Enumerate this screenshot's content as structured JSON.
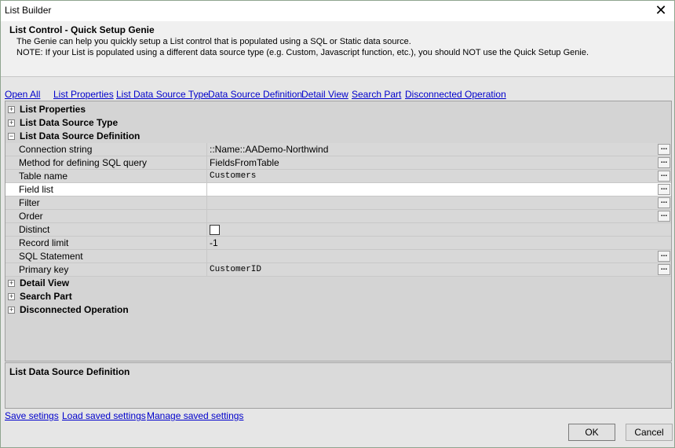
{
  "window": {
    "title": "List Builder",
    "close_glyph": "✕"
  },
  "header": {
    "title": "List Control - Quick Setup Genie",
    "line1": "The Genie can help you quickly setup a List control that is populated using a SQL or Static data source.",
    "line2": "NOTE: If your List is populated using a different data source type (e.g. Custom, Javascript function, etc.), you should NOT use the Quick Setup Genie."
  },
  "nav": {
    "open_all": "Open All",
    "list_properties": "List Properties",
    "list_data_source_type": "List Data Source Type",
    "data_source_definition": "Data Source Definition",
    "detail_view": "Detail View",
    "search_part": "Search Part",
    "disconnected_operation": "Disconnected Operation"
  },
  "grid": {
    "categories": {
      "list_properties": {
        "label": "List Properties",
        "toggle": "+"
      },
      "list_data_source_type": {
        "label": "List Data Source Type",
        "toggle": "+"
      },
      "list_data_source_definition": {
        "label": "List Data Source Definition",
        "toggle": "−"
      },
      "detail_view": {
        "label": "Detail View",
        "toggle": "+"
      },
      "search_part": {
        "label": "Search Part",
        "toggle": "+"
      },
      "disconnected_operation": {
        "label": "Disconnected Operation",
        "toggle": "+"
      }
    },
    "props": {
      "connection_string": {
        "label": "Connection string",
        "value": "::Name::AADemo-Northwind"
      },
      "method": {
        "label": "Method for defining SQL query",
        "value": "FieldsFromTable"
      },
      "table_name": {
        "label": "Table name",
        "value": "Customers"
      },
      "field_list": {
        "label": "Field list",
        "value": ""
      },
      "filter": {
        "label": "Filter",
        "value": ""
      },
      "order": {
        "label": "Order",
        "value": ""
      },
      "distinct": {
        "label": "Distinct",
        "checked": false
      },
      "record_limit": {
        "label": "Record limit",
        "value": "-1"
      },
      "sql_statement": {
        "label": "SQL Statement",
        "value": ""
      },
      "primary_key": {
        "label": "Primary key",
        "value": "CustomerID"
      }
    },
    "ellipsis": "..."
  },
  "description": {
    "title": "List Data Source Definition"
  },
  "footer": {
    "save_settings": "Save setings",
    "load_saved_settings": "Load saved settings",
    "manage_saved_settings": "Manage saved settings"
  },
  "buttons": {
    "ok": "OK",
    "cancel": "Cancel"
  }
}
